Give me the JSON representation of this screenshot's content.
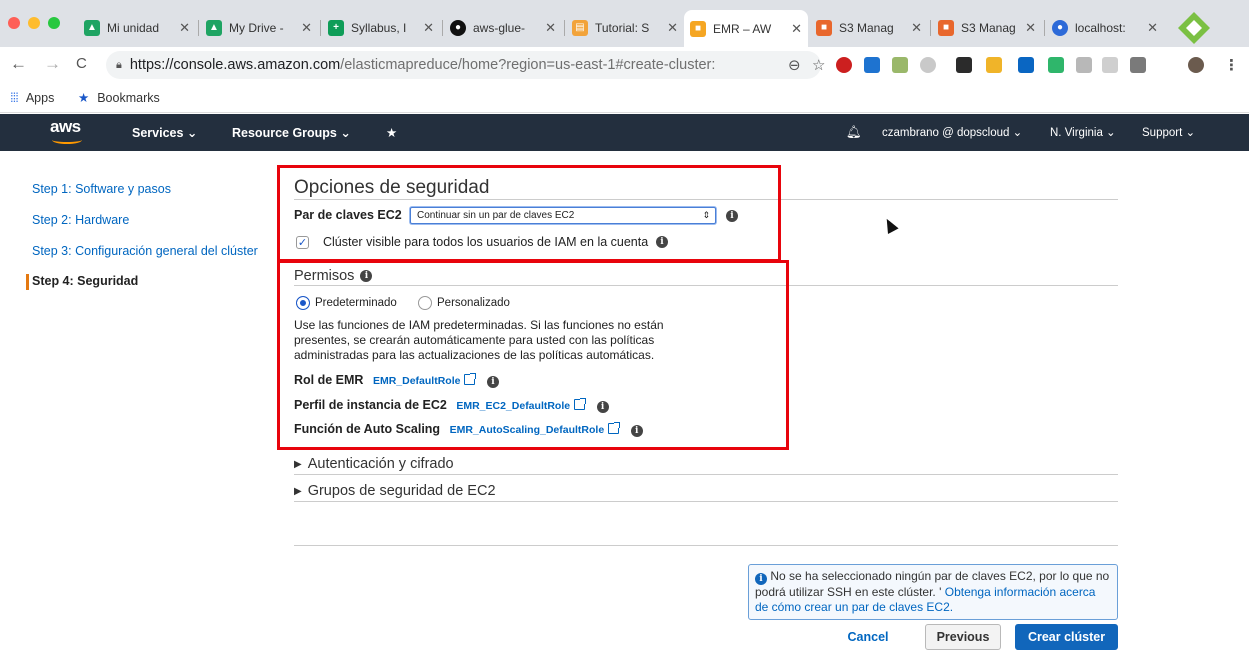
{
  "browser": {
    "tabs": [
      {
        "label": "Mi unidad",
        "icon": "google-drive-icon",
        "color": "#1fa463"
      },
      {
        "label": "My Drive -",
        "icon": "google-drive-icon",
        "color": "#1fa463"
      },
      {
        "label": "Syllabus, I",
        "icon": "google-sheets-icon",
        "color": "#0f9d58"
      },
      {
        "label": "aws-glue-",
        "icon": "github-icon",
        "color": "#111111"
      },
      {
        "label": "Tutorial: S",
        "icon": "docs-icon",
        "color": "#f2a33a"
      },
      {
        "label": "EMR – AW",
        "icon": "aws-box-icon",
        "color": "#f5a623"
      },
      {
        "label": "S3 Manag",
        "icon": "aws-box-icon",
        "color": "#e8672d"
      },
      {
        "label": "S3 Manag",
        "icon": "aws-box-icon",
        "color": "#e8672d"
      },
      {
        "label": "localhost:",
        "icon": "globe-icon",
        "color": "#2d6ad8"
      }
    ],
    "url_host": "https://console.aws.amazon.com",
    "url_path": "/elasticmapreduce/home?region=us-east-1#create-cluster:",
    "bookmarks": {
      "apps": "Apps",
      "bookmarks": "Bookmarks"
    }
  },
  "aws_nav": {
    "logo": "aws",
    "services": "Services",
    "resource_groups": "Resource Groups",
    "user": "czambrano @ dopscloud",
    "region": "N. Virginia",
    "support": "Support"
  },
  "steps": [
    "Step 1: Software y pasos",
    "Step 2: Hardware",
    "Step 3: Configuración general del clúster",
    "Step 4: Seguridad"
  ],
  "security": {
    "title": "Opciones de seguridad",
    "keypair_label": "Par de claves EC2",
    "keypair_value": "Continuar sin un par de claves EC2",
    "visible_label": "Clúster visible para todos los usuarios de IAM en la cuenta",
    "visible_checked": true
  },
  "permissions": {
    "title": "Permisos",
    "opt_default": "Predeterminado",
    "opt_custom": "Personalizado",
    "desc1": "Use las funciones de IAM predeterminadas. Si las funciones no están",
    "desc2": "presentes, se crearán automáticamente para usted con las políticas",
    "desc3": "administradas para las actualizaciones de las políticas automáticas.",
    "role_label": "Rol de EMR",
    "role_value": "EMR_DefaultRole",
    "profile_label": "Perfil de instancia de EC2",
    "profile_value": "EMR_EC2_DefaultRole",
    "autoscale_label": "Función de Auto Scaling",
    "autoscale_value": "EMR_AutoScaling_DefaultRole"
  },
  "sections": {
    "auth": "Autenticación y cifrado",
    "groups": "Grupos de seguridad de EC2"
  },
  "notice": {
    "text": "No se ha seleccionado ningún par de claves EC2, por lo que no podrá utilizar SSH en este clúster. '",
    "link": "Obtenga información acerca de cómo crear un par de claves EC2."
  },
  "buttons": {
    "cancel": "Cancel",
    "previous": "Previous",
    "create": "Crear clúster"
  },
  "colors": {
    "primary": "#1166bb",
    "highlight": "#e8040c",
    "nav": "#232f3e"
  }
}
